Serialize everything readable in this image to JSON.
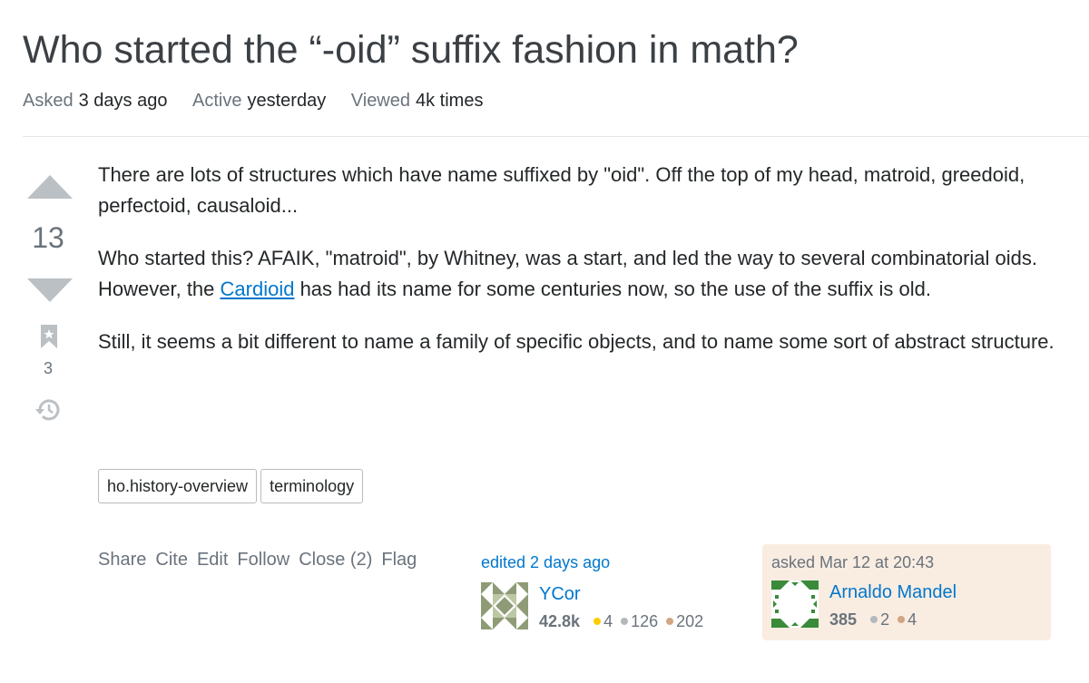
{
  "question": {
    "title": "Who started the “-oid” suffix fashion in math?",
    "meta": {
      "asked_label": "Asked",
      "asked_value": "3 days ago",
      "active_label": "Active",
      "active_value": "yesterday",
      "viewed_label": "Viewed",
      "viewed_value": "4k times"
    },
    "votes": "13",
    "bookmarks": "3",
    "body": {
      "p1": "There are lots of structures which have name suffixed by \"oid\". Off the top of my head, matroid, greedoid, perfectoid, causaloid...",
      "p2_before": "Who started this? AFAIK, \"matroid\", by Whitney, was a start, and led the way to several combinatorial oids. However, the ",
      "p2_link": "Cardioid",
      "p2_after": " has had its name for some centuries now, so the use of the suffix is old.",
      "p3": "Still, it seems a bit different to name a family of specific objects, and to name some sort of abstract structure."
    },
    "tags": [
      "ho.history-overview",
      "terminology"
    ],
    "actions": [
      "Share",
      "Cite",
      "Edit",
      "Follow",
      "Close (2)",
      "Flag"
    ]
  },
  "editor": {
    "edited_text": "edited 2 days ago",
    "name": "YCor",
    "reputation": "42.8k",
    "gold": "4",
    "silver": "126",
    "bronze": "202",
    "avatar_icon": "identicon-green"
  },
  "owner": {
    "asked_text": "asked Mar 12 at 20:43",
    "name": "Arnaldo Mandel",
    "reputation": "385",
    "silver": "2",
    "bronze": "4",
    "avatar_icon": "identicon-green-white",
    "card_color": "#f9ece1"
  },
  "colors": {
    "link": "#0077cc",
    "muted": "#6a737c",
    "gold_badge": "#ffcc01",
    "silver_badge": "#b4b8bc",
    "bronze_badge": "#d1a684"
  }
}
